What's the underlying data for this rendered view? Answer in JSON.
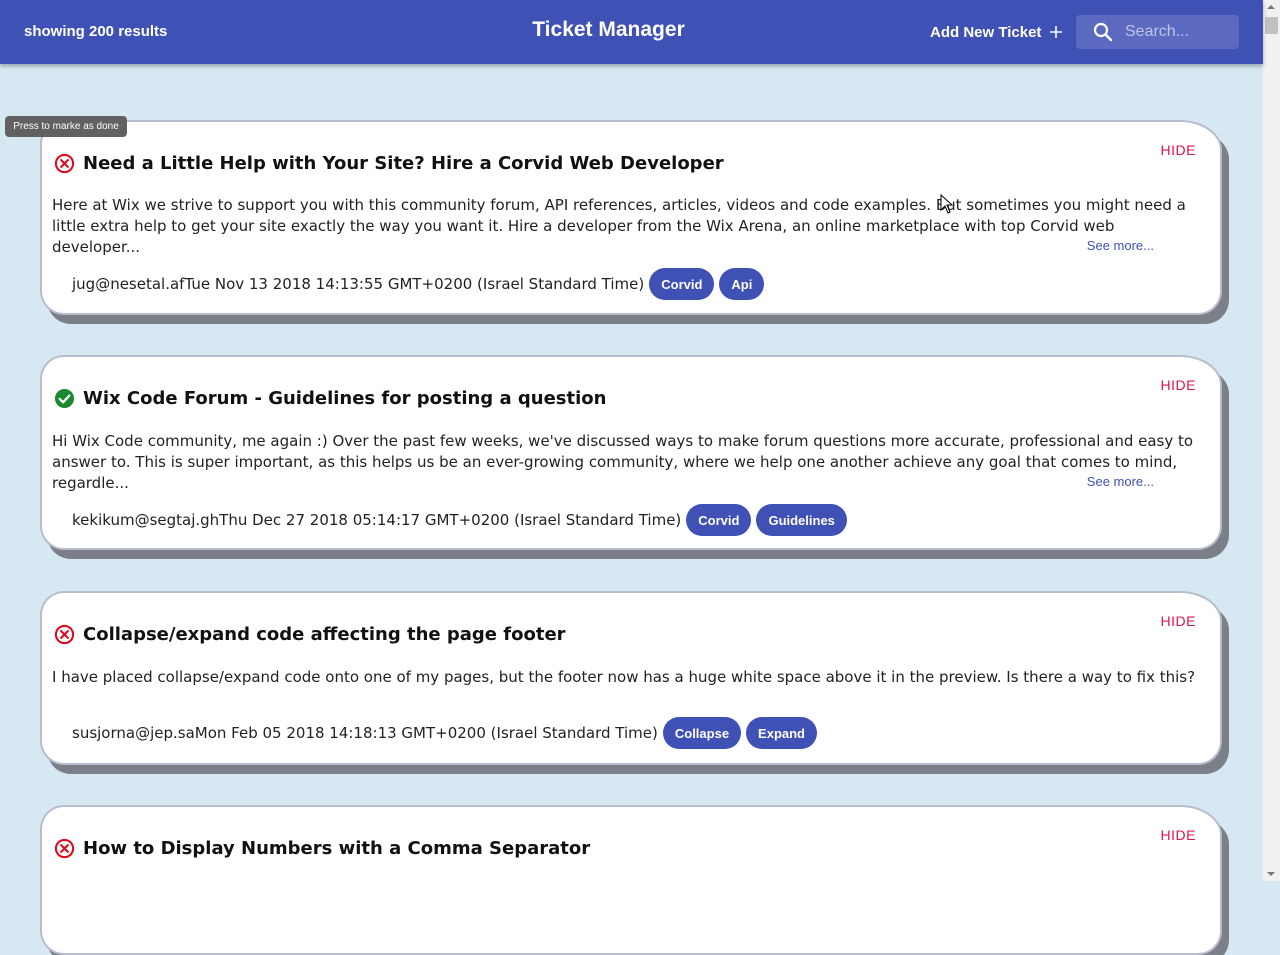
{
  "header": {
    "results_text": "showing 200 results",
    "title": "Ticket Manager",
    "add_label": "Add New Ticket",
    "search_placeholder": "Search...",
    "bar_color": "#3f51b5"
  },
  "tooltip": "Press to marke as done",
  "see_more_label": "See more...",
  "hide_label": "HIDE",
  "tickets": [
    {
      "status": "not-done",
      "title": "Need a Little Help with Your Site? Hire a Corvid Web Developer",
      "body": "Here at Wix we strive to support you with this community forum, API references, articles, videos and code examples. But sometimes you might need a little extra help to get your site exactly the way you want it. Hire a developer from the Wix Arena, an online marketplace with top Corvid web developer...",
      "meta": "jug@nesetal.afTue Nov 13 2018 14:13:55 GMT+0200 (Israel Standard Time)",
      "labels": [
        "Corvid",
        "Api"
      ]
    },
    {
      "status": "done",
      "title": "Wix Code Forum - Guidelines for posting a question",
      "body": "Hi Wix Code community, me again :) Over the past few weeks, we've discussed ways to make forum questions more accurate, professional and easy to answer to. This is super important, as this helps us be an ever-growing community, where we help one another achieve any goal that comes to mind, regardle...",
      "meta": "kekikum@segtaj.ghThu Dec 27 2018 05:14:17 GMT+0200 (Israel Standard Time)",
      "labels": [
        "Corvid",
        "Guidelines"
      ]
    },
    {
      "status": "not-done",
      "title": "Collapse/expand code affecting the page footer",
      "body": "I have placed collapse/expand code onto one of my pages, but the footer now has a huge white space above it in the preview. Is there a way to fix this?",
      "meta": "susjorna@jep.saMon Feb 05 2018 14:18:13 GMT+0200 (Israel Standard Time)",
      "labels": [
        "Collapse",
        "Expand"
      ]
    },
    {
      "status": "not-done",
      "title": "How to Display Numbers with a Comma Separator"
    }
  ]
}
